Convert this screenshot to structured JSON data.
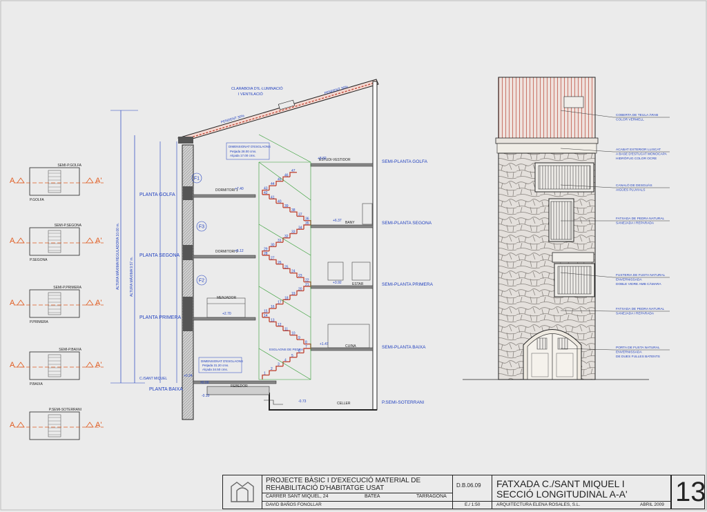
{
  "key_plans": [
    {
      "title": "SEMI-P.GOLFA",
      "caption": "P.GOLFA",
      "cut": "A",
      "cut_end": "A'"
    },
    {
      "title": "SEMI-P.SEGONA",
      "caption": "P.SEGONA",
      "cut": "A",
      "cut_end": "A'"
    },
    {
      "title": "SEMI-P.PRIMERA",
      "caption": "P.PRIMERA",
      "cut": "A",
      "cut_end": "A'"
    },
    {
      "title": "SEMI-P.BAIXA",
      "caption": "P.BAIXA",
      "cut": "A",
      "cut_end": "A'"
    },
    {
      "title": "P.SEMI-SOTERRANI",
      "caption": "",
      "cut": "A",
      "cut_end": "A'"
    }
  ],
  "section": {
    "roof_notes": {
      "skylight_1": "CLARABOIA D'IL·LUMINACIÓ",
      "skylight_2": "I VENTILACIÓ",
      "slope_left": "PENDENT 30%",
      "slope_right": "PENDENT 30%"
    },
    "vertical_dims": {
      "total_height": "ALTURA MÀXIMA REGULADORA 10.00 m.",
      "lower_height": "ALTURA MÀXIMA 9.57 m."
    },
    "stair_notes": {
      "upper_title": "DIMENSIONAT D'ESGLAONS",
      "upper_tread": "Petjada      28.00 cms.",
      "upper_riser": "Alçada      17.00 cms.",
      "lower_title": "DIMENSIONAT D'ESGLAONS",
      "lower_tread": "Petjada      31.20 cms.",
      "lower_riser": "Alçada      34.50 cms.",
      "stone_steps": "ESGLAONS DE PEDRA"
    },
    "floor_labels_left": [
      "PLANTA GOLFA",
      "PLANTA SEGONA",
      "PLANTA PRIMERA",
      "C./SANT MIQUEL",
      "PLANTA BAIXA"
    ],
    "floor_labels_right": [
      "SEMI-PLANTA GOLFA",
      "SEMI-PLANTA SEGONA",
      "SEMI-PLANTA PRIMERA",
      "SEMI-PLANTA BAIXA",
      "P.SEMI-SOTERRANI"
    ],
    "rooms": [
      "ESTUDI-VESTIDOR",
      "DORMITORI 1",
      "BANY",
      "DORMITORI 2",
      "ESTAR",
      "MENJADOR",
      "CUINA",
      "REBEDOR",
      "CELLER"
    ],
    "levels": [
      "+8.82",
      "+7.40",
      "+6.37",
      "+5.12",
      "+3.92",
      "+2.70",
      "+1.47",
      "+0.24",
      "±0.00",
      "-0.10",
      "-0.73"
    ],
    "window_tags": [
      "F1",
      "F3",
      "F2"
    ],
    "step_numbers": [
      "1",
      "2",
      "3",
      "4",
      "5",
      "6",
      "7",
      "8",
      "9",
      "10",
      "11",
      "12",
      "13",
      "14",
      "15",
      "16",
      "17",
      "18",
      "19",
      "20",
      "21",
      "22",
      "23",
      "24",
      "25",
      "26",
      "27",
      "28",
      "29",
      "30",
      "31",
      "32",
      "33",
      "34",
      "35",
      "36",
      "37",
      "38",
      "39",
      "40",
      "41",
      "42",
      "43",
      "44",
      "45",
      "46",
      "47"
    ]
  },
  "facade": {
    "notes": [
      [
        "COBERTA DE TEULA ÀRAB",
        "COLOR VERMELL"
      ],
      [
        "ACABAT EXTERIOR LLISCAT",
        "A BASE D'ESTUCAT MONOCAPA",
        "HIDRÒFUG COLOR OCRE"
      ],
      [
        "CANALÓ DE DESGUÀS",
        "AIGÜES PLUVIALS"
      ],
      [
        "FATXADA DE PEDRA NATURAL",
        "SANEJADA I REPARADA"
      ],
      [
        "FUSTERIA DE FUSTA NATURAL",
        "ENVERNISSADA",
        "DOBLE VIDRE AMB CÀMARA"
      ],
      [
        "FATXADA DE PEDRA NATURAL",
        "SANEJADA I REPARADA"
      ],
      [
        "PORTA DE FUSTA NATURAL",
        "ENVERNISSADA",
        "DE DUES FULLES BATENTS"
      ]
    ]
  },
  "title_block": {
    "project_line1": "PROJECTE BÀSIC I D'EXECUCIÓ MATERIAL DE",
    "project_line2": "REHABILITACIÓ D'HABITATGE USAT",
    "code": "D.B.06.09",
    "address": "CARRER SANT MIQUEL, 24",
    "town": "BATEA",
    "province": "TARRAGONA",
    "client": "DAVID BAÑOS FONOLLAR",
    "scale": "E./ 1:50",
    "drawing_line1": "FATXADA C./SANT MIQUEL I",
    "drawing_line2": "SECCIÓ LONGITUDINAL A-A'",
    "architect": "ARQUITECTURA ELENA ROSALES, S.L.",
    "date": "ABRIL 2009",
    "sheet_number": "13"
  },
  "colors": {
    "line": "#222222",
    "dim": "#1f3fbf",
    "cut_marker": "#e05a1e",
    "stair": "#2e9b2e",
    "roof": "#c04a3a",
    "paper": "#ebebeb"
  }
}
